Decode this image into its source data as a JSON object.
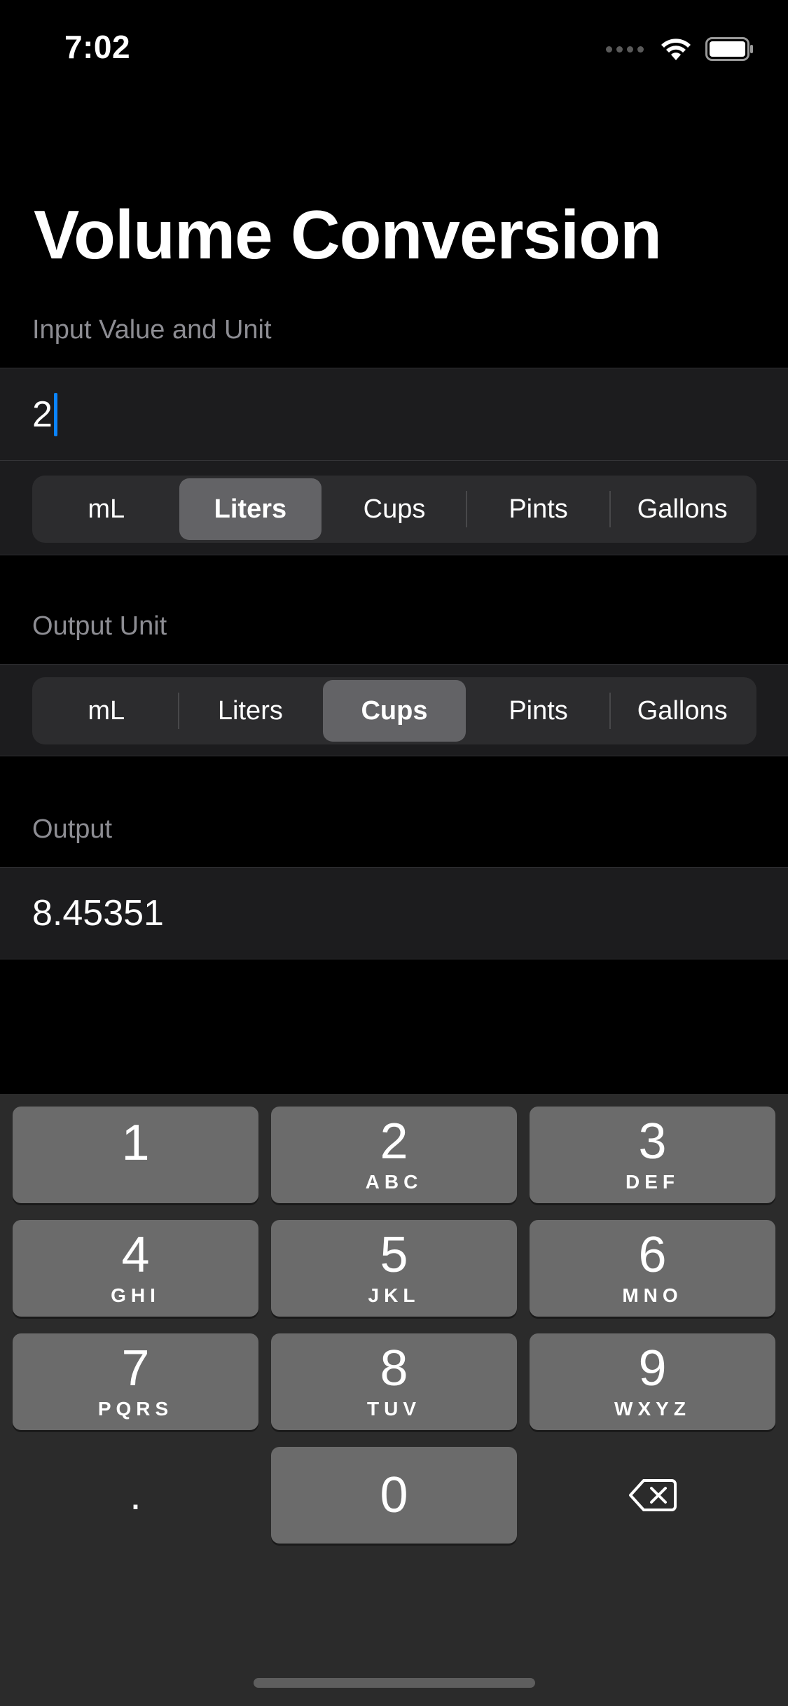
{
  "status_bar": {
    "time": "7:02",
    "icons": [
      "cellular-signal-icon",
      "wifi-icon",
      "battery-icon"
    ]
  },
  "page": {
    "title": "Volume Conversion"
  },
  "input_section": {
    "header": "Input Value and Unit",
    "value": "2",
    "units": [
      "mL",
      "Liters",
      "Cups",
      "Pints",
      "Gallons"
    ],
    "selected_unit": "Liters"
  },
  "output_unit_section": {
    "header": "Output Unit",
    "units": [
      "mL",
      "Liters",
      "Cups",
      "Pints",
      "Gallons"
    ],
    "selected_unit": "Cups"
  },
  "output_section": {
    "header": "Output",
    "value": "8.45351"
  },
  "keyboard": {
    "keys": [
      {
        "num": "1",
        "letters": ""
      },
      {
        "num": "2",
        "letters": "ABC"
      },
      {
        "num": "3",
        "letters": "DEF"
      },
      {
        "num": "4",
        "letters": "GHI"
      },
      {
        "num": "5",
        "letters": "JKL"
      },
      {
        "num": "6",
        "letters": "MNO"
      },
      {
        "num": "7",
        "letters": "PQRS"
      },
      {
        "num": "8",
        "letters": "TUV"
      },
      {
        "num": "9",
        "letters": "WXYZ"
      },
      {
        "num": "0",
        "letters": ""
      }
    ],
    "decimal": ".",
    "delete_icon": "backspace-icon"
  },
  "colors": {
    "background": "#000000",
    "group_background": "#1c1c1e",
    "segment_background": "#2c2c2e",
    "segment_selected": "#636366",
    "caret": "#0a84ff",
    "secondary_text": "#8d8d93",
    "keyboard_background": "#2b2b2b",
    "key_background": "#6b6b6b"
  }
}
